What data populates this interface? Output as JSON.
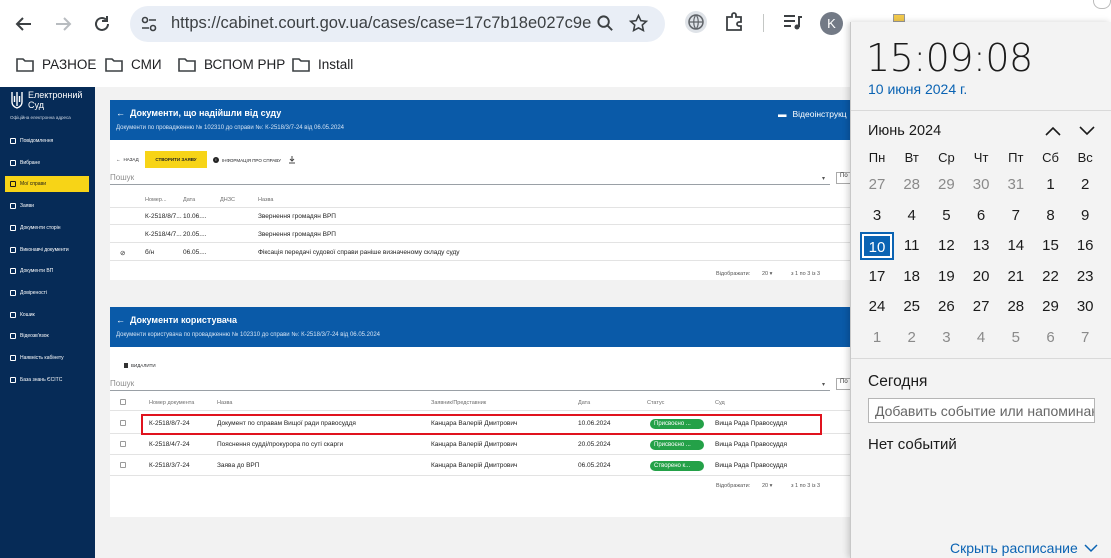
{
  "browser": {
    "url": "https://cabinet.court.gov.ua/cases/case=17c7b18e027c9ec5e...",
    "profile_initial": "K",
    "bookmarks": [
      "РАЗНОЕ",
      "СМИ",
      "ВСПОМ РНР",
      "Install"
    ]
  },
  "site": {
    "logo_title": "Електронний Суд",
    "logo_subtitle": "Офіційна електронна адреса",
    "menu": [
      {
        "label": "Повідомлення",
        "icon": "message-icon",
        "active": false
      },
      {
        "label": "Вибране",
        "icon": "star-icon",
        "active": false
      },
      {
        "label": "Мої справи",
        "icon": "folder-icon",
        "active": true
      },
      {
        "label": "Заяви",
        "icon": "mail-icon",
        "active": false
      },
      {
        "label": "Документи сторін",
        "icon": "documents-icon",
        "active": false
      },
      {
        "label": "Виконавчі документи",
        "icon": "stack-icon",
        "active": false
      },
      {
        "label": "Документи ВП",
        "icon": "document-icon",
        "active": false
      },
      {
        "label": "Довіреності",
        "icon": "users-icon",
        "active": false
      },
      {
        "label": "Кошик",
        "icon": "cart-icon",
        "active": false
      },
      {
        "label": "Відеозв'язок",
        "icon": "video-icon",
        "active": false
      },
      {
        "label": "Наявність кабінету",
        "icon": "user-icon",
        "active": false
      },
      {
        "label": "База знань ЄСІТС",
        "icon": "info-icon",
        "active": false
      }
    ],
    "court_docs": {
      "title": "Документи, що надійшли від суду",
      "subtitle": "Документи по провадженню № 102310 до справи №: К-2518/3/7-24 від 06.05.2024",
      "video_link": "Відеоінструкц",
      "back_label": "НАЗАД",
      "create_label": "СТВОРИТИ ЗАЯВУ",
      "info_label": "ІНФОРМАЦІЯ ПРО СПРАВУ",
      "search_placeholder": "Пошук",
      "select_value": "По",
      "columns": [
        "Номер...",
        "Дата",
        "ДНЗС",
        "Назва"
      ],
      "rows": [
        {
          "number": "К-2518/8/7...",
          "date": "10.06....",
          "dnzs": "",
          "name": "Звернення громадян ВРП",
          "attachment": false
        },
        {
          "number": "К-2518/4/7...",
          "date": "20.05....",
          "dnzs": "",
          "name": "Звернення громадян ВРП",
          "attachment": false
        },
        {
          "number": "б/н",
          "date": "06.05....",
          "dnzs": "",
          "name": "Фіксація передачі судової справи раніше визначеному складу суду",
          "attachment": true
        }
      ],
      "pager_label": "Відображати:",
      "pager_size": "20",
      "pager_range": "з 1 по 3 із 3"
    },
    "user_docs": {
      "title": "Документи користувача",
      "subtitle": "Документи користувача по провадженню № 102310 до справи №: К-2518/3/7-24 від 06.05.2024",
      "delete_label": "ВИДАЛИТИ",
      "search_placeholder": "Пошук",
      "select_value": "По",
      "columns": [
        "Номер документа",
        "Назва",
        "Заявник/Представник",
        "Дата",
        "Статус",
        "Суд"
      ],
      "rows": [
        {
          "number": "К-2518/8/7-24",
          "name": "Документ по справам Вищої ради правосуддя",
          "applicant": "Канцара Валерій Дмитрович",
          "date": "10.06.2024",
          "status": "Присвоєно ...",
          "court": "Вища Рада Правосуддя",
          "highlighted": true
        },
        {
          "number": "К-2518/4/7-24",
          "name": "Пояснення судді/прокурора по суті скарги",
          "applicant": "Канцара Валерій Дмитрович",
          "date": "20.05.2024",
          "status": "Присвоєно ...",
          "court": "Вища Рада Правосуддя",
          "highlighted": false
        },
        {
          "number": "К-2518/3/7-24",
          "name": "Заява до ВРП",
          "applicant": "Канцара Валерій Дмитрович",
          "date": "06.05.2024",
          "status": "Створено к...",
          "court": "Вища Рада Правосуддя",
          "highlighted": false
        }
      ],
      "pager_label": "Відображати:",
      "pager_size": "20",
      "pager_range": "з 1 по 3 із 3"
    }
  },
  "calendar": {
    "time": "15:09:08",
    "date": "10 июня 2024 г.",
    "month": "Июнь 2024",
    "weekdays": [
      "Пн",
      "Вт",
      "Ср",
      "Чт",
      "Пт",
      "Сб",
      "Вс"
    ],
    "weeks": [
      [
        "27",
        "28",
        "29",
        "30",
        "31",
        "1",
        "2"
      ],
      [
        "3",
        "4",
        "5",
        "6",
        "7",
        "8",
        "9"
      ],
      [
        "10",
        "11",
        "12",
        "13",
        "14",
        "15",
        "16"
      ],
      [
        "17",
        "18",
        "19",
        "20",
        "21",
        "22",
        "23"
      ],
      [
        "24",
        "25",
        "26",
        "27",
        "28",
        "29",
        "30"
      ],
      [
        "1",
        "2",
        "3",
        "4",
        "5",
        "6",
        "7"
      ]
    ],
    "today_label": "Сегодня",
    "event_placeholder": "Добавить событие или напоминание",
    "no_events": "Нет событий",
    "schedule_link": "Скрыть расписание"
  },
  "colors": {
    "accent": "#0a5aa8",
    "sidebar": "#062b57",
    "active_menu": "#f7d417",
    "status": "#24a148",
    "highlight": "#e0131e"
  }
}
